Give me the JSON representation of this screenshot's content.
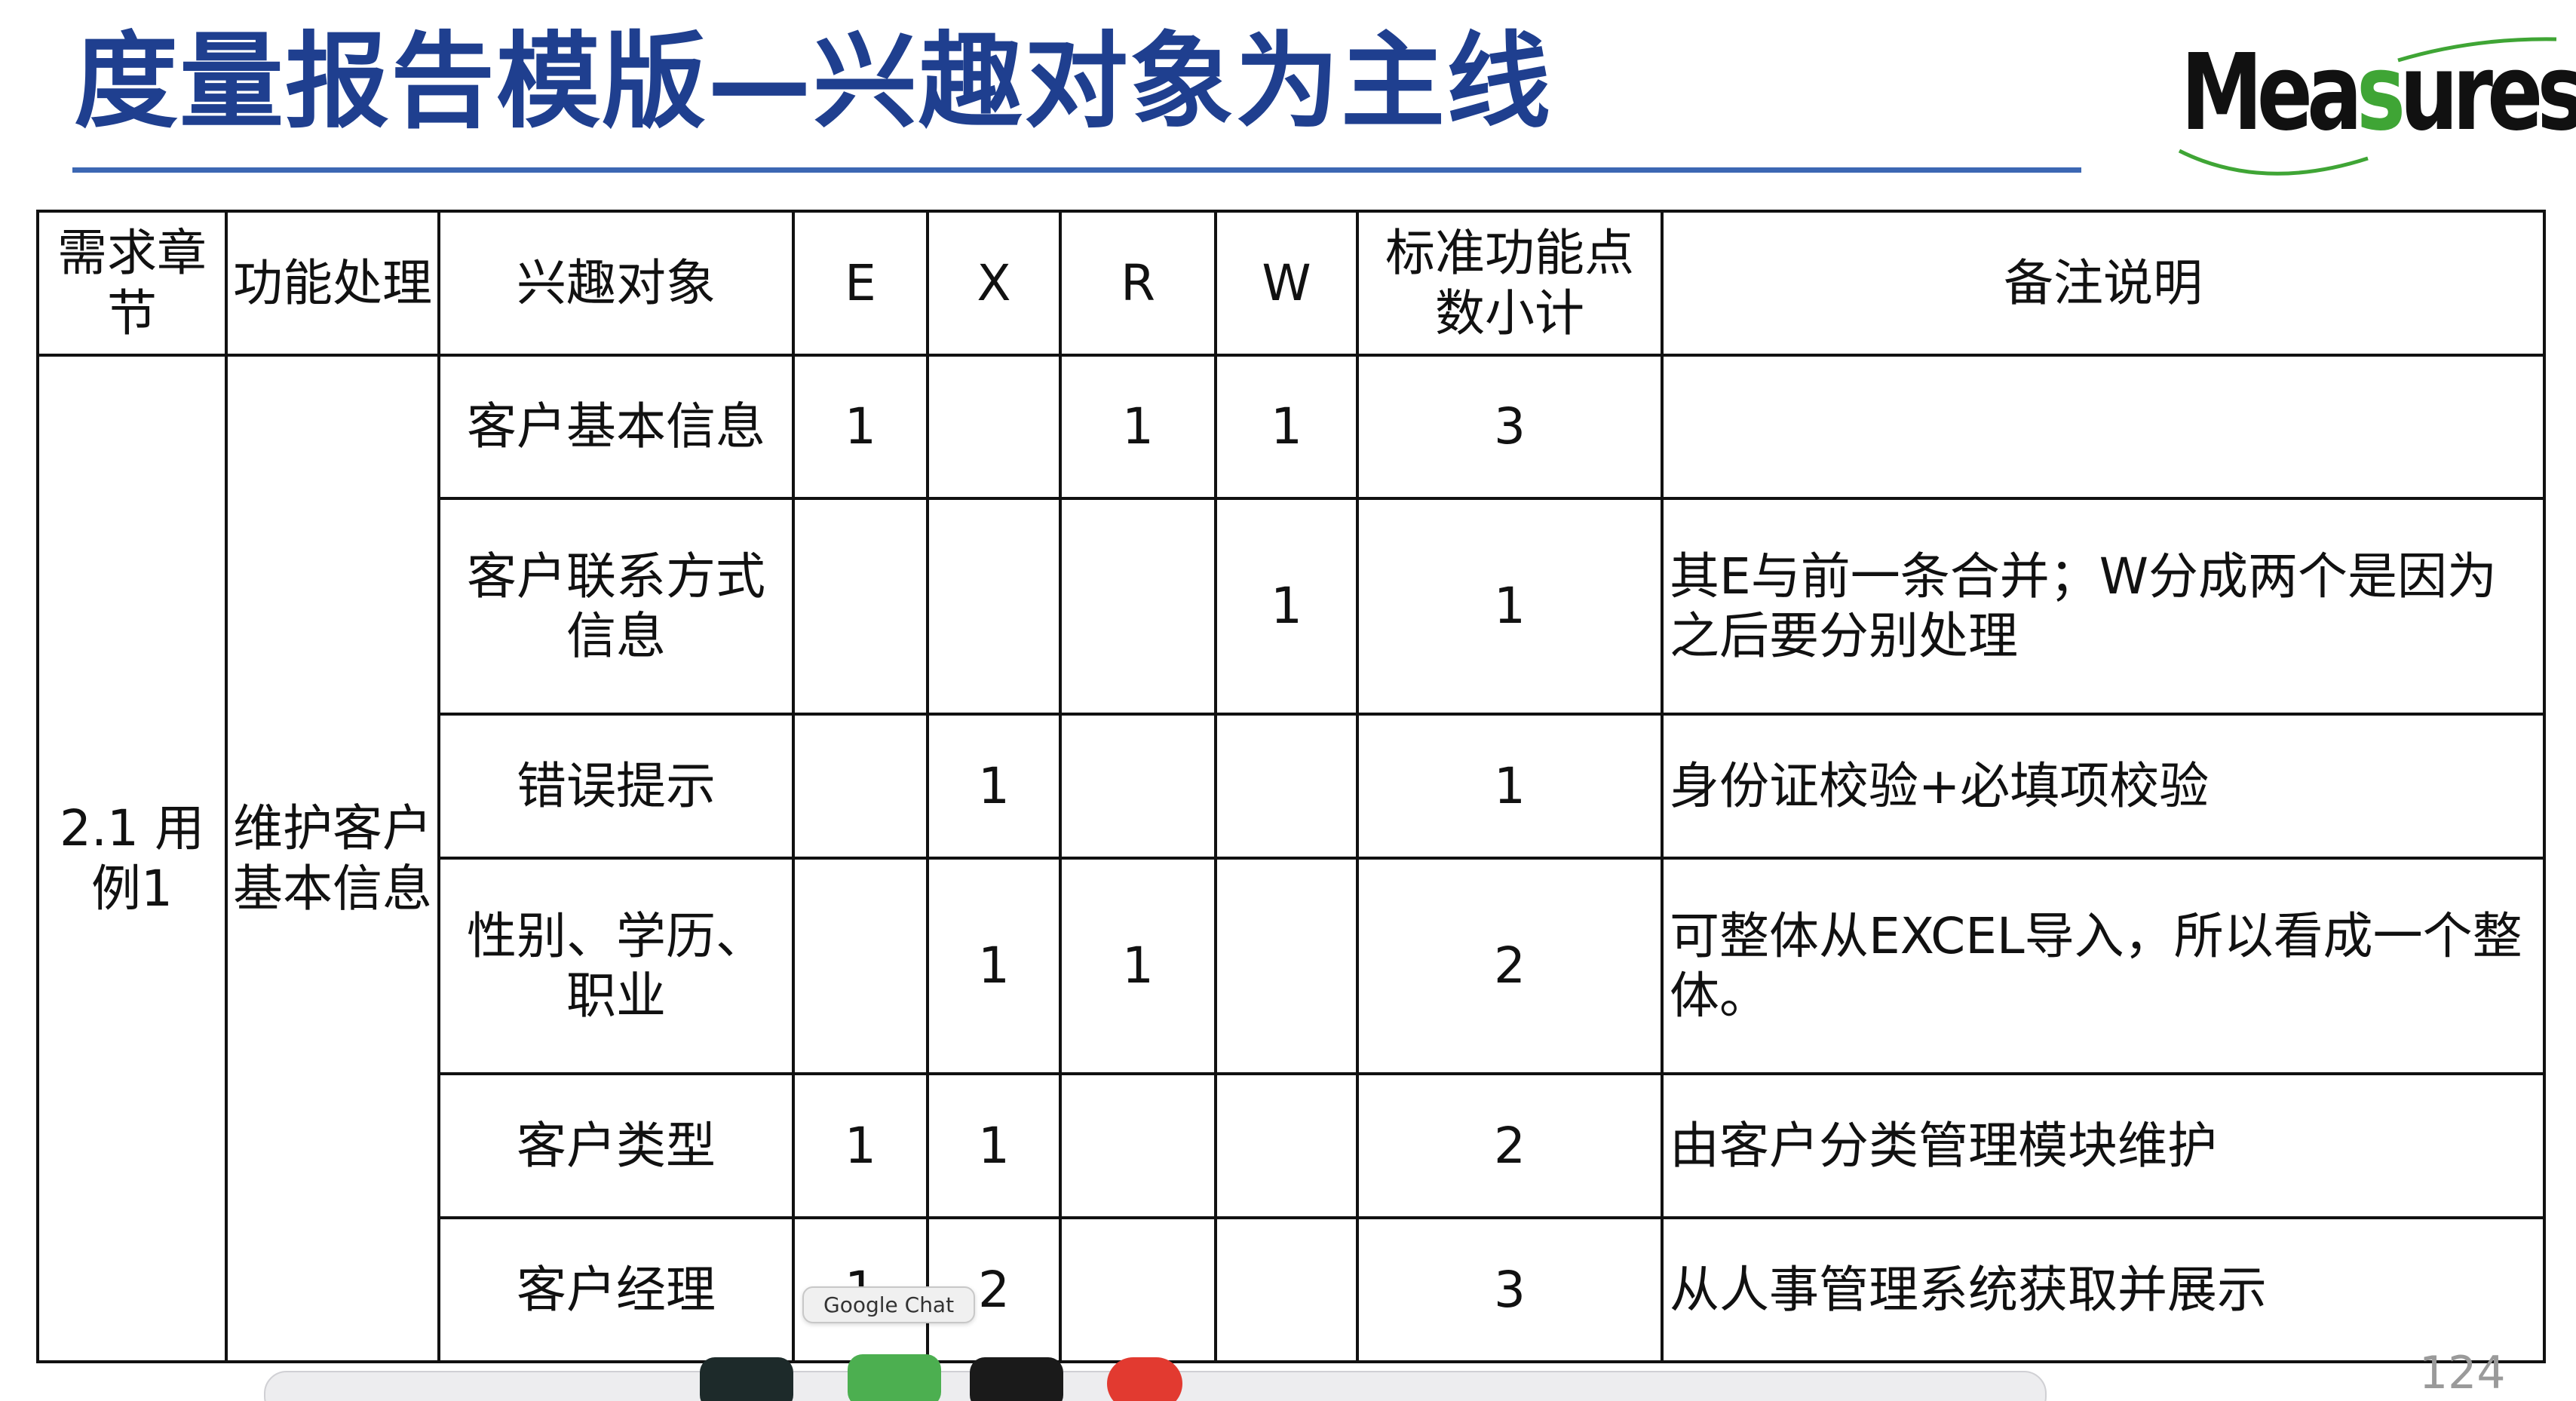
{
  "slide": {
    "title": "度量报告模版—兴趣对象为主线",
    "logo": {
      "prefix": "Mea",
      "accent": "s",
      "suffix": "ures",
      "accent_color": "#3fa535"
    },
    "page_number": "124",
    "title_color": "#1f3f8f"
  },
  "table": {
    "headers": [
      "需求章节",
      "功能处理",
      "兴趣对象",
      "E",
      "X",
      "R",
      "W",
      "标准功能点数小计",
      "备注说明"
    ],
    "chapter": "2.1 用例1",
    "process": "维护客户基本信息",
    "rows": [
      {
        "object": "客户基本信息",
        "E": "1",
        "X": "",
        "R": "1",
        "W": "1",
        "total": "3",
        "note": ""
      },
      {
        "object": "客户联系方式信息",
        "E": "",
        "X": "",
        "R": "",
        "W": "1",
        "total": "1",
        "note": "其E与前一条合并；W分成两个是因为之后要分别处理"
      },
      {
        "object": "错误提示",
        "E": "",
        "X": "1",
        "R": "",
        "W": "",
        "total": "1",
        "note": "身份证校验+必填项校验"
      },
      {
        "object": "性别、学历、职业",
        "E": "",
        "X": "1",
        "R": "1",
        "W": "",
        "total": "2",
        "note": "可整体从EXCEL导入，所以看成一个整体。"
      },
      {
        "object": "客户类型",
        "E": "1",
        "X": "1",
        "R": "",
        "W": "",
        "total": "2",
        "note": "由客户分类管理模块维护"
      },
      {
        "object": "客户经理",
        "E": "1",
        "X": "2",
        "R": "",
        "W": "",
        "total": "3",
        "note": "从人事管理系统获取并展示"
      }
    ]
  },
  "overlay": {
    "tooltip": "Google Chat",
    "dock_icons": [
      "activity-monitor-icon",
      "google-chat-icon",
      "terminal-icon",
      "record-icon"
    ]
  }
}
